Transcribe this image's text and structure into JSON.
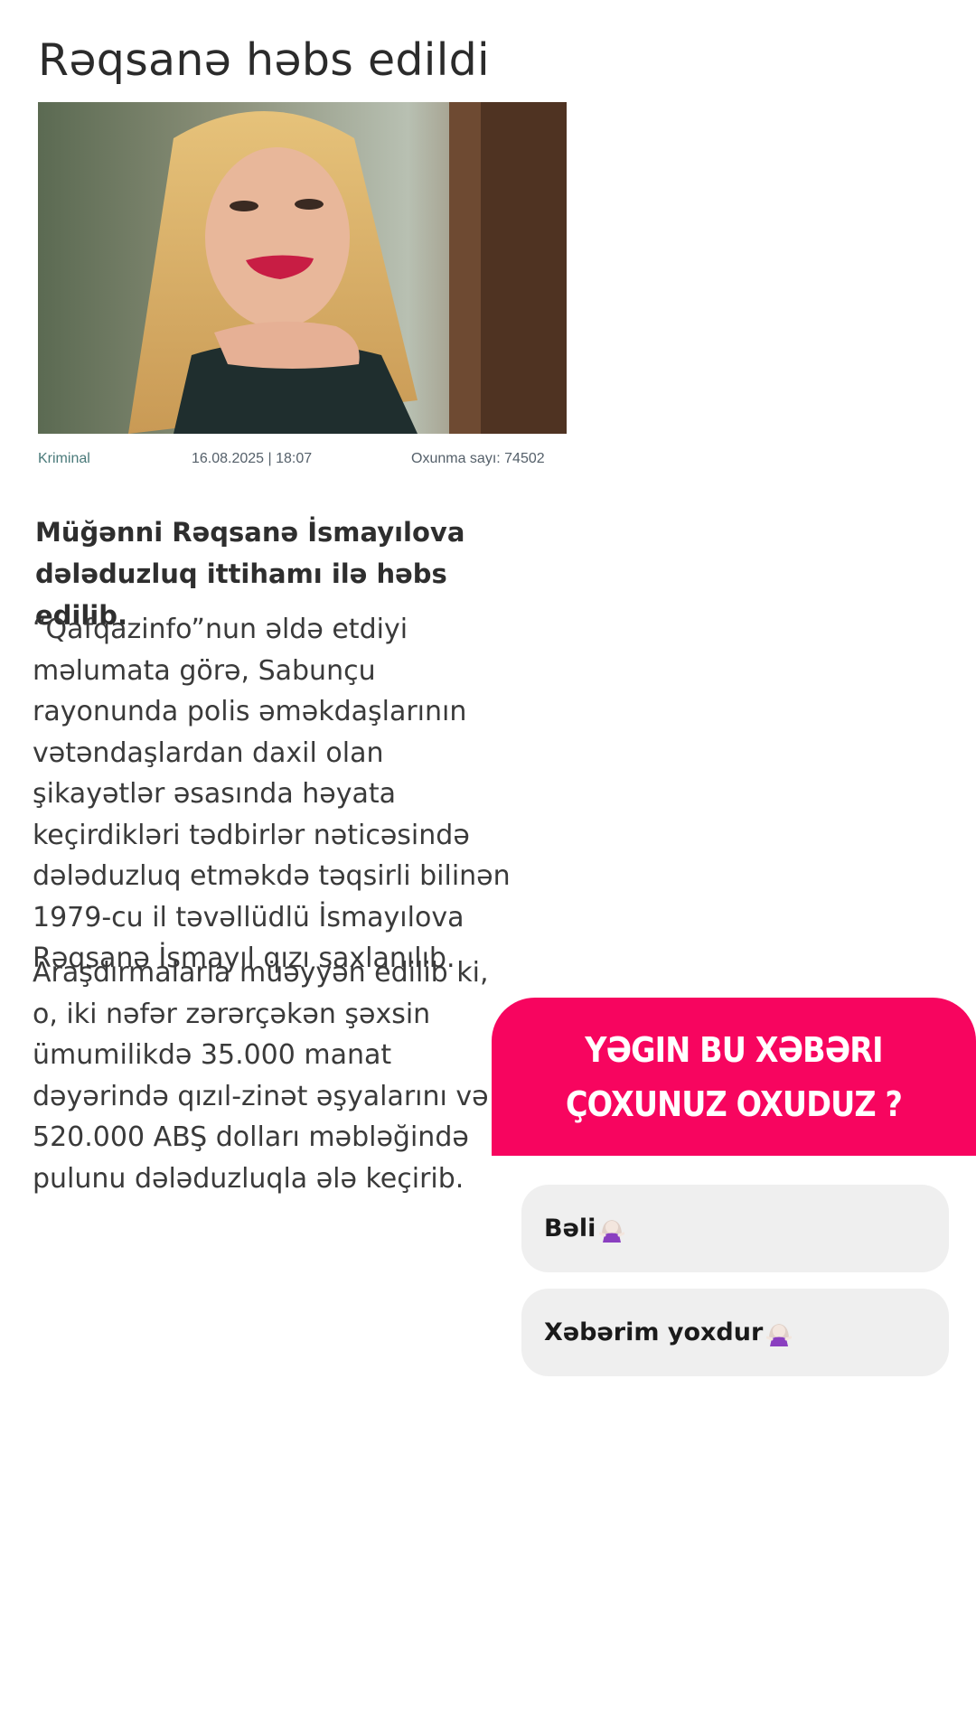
{
  "article": {
    "title": "Rəqsanə həbs edildi",
    "photo_icon": "portrait-photo",
    "meta": {
      "category": "Kriminal",
      "date": "16.08.2025 | 18:07",
      "views": "Oxunma sayı: 74502"
    },
    "lead": "Müğənni Rəqsanə İsmayılova dələduzluq ittihamı ilə həbs edilib.",
    "paragraphs": [
      "“Qafqazinfo”nun əldə etdiyi məlumata görə, Sabunçu rayonunda polis əməkdaşlarının vətəndaşlardan daxil olan şikayətlər əsasında həyata keçirdikləri tədbirlər nəticəsində dələduzluq etməkdə təqsirli bilinən 1979-cu il təvəllüdlü İsmayılova Rəqsanə İsmayıl qızı saxlanılıb.",
      "Araşdırmalarla müəyyən edilib ki, o, iki nəfər zərərçəkən şəxsin ümumilikdə 35.000 manat dəyərində qızıl-zinət əşyalarını və 520.000 ABŞ dolları məbləğində pulunu dələduzluqla ələ keçirib."
    ]
  },
  "poll": {
    "question": "YƏGIN BU XƏBƏRI ÇOXUNUZ OXUDUZ ?",
    "accent_color": "#f7055f",
    "options": [
      {
        "label": "Bəli",
        "icon": "shrug-woman-icon"
      },
      {
        "label": "Xəbərim yoxdur",
        "icon": "shrug-woman-icon"
      }
    ]
  }
}
